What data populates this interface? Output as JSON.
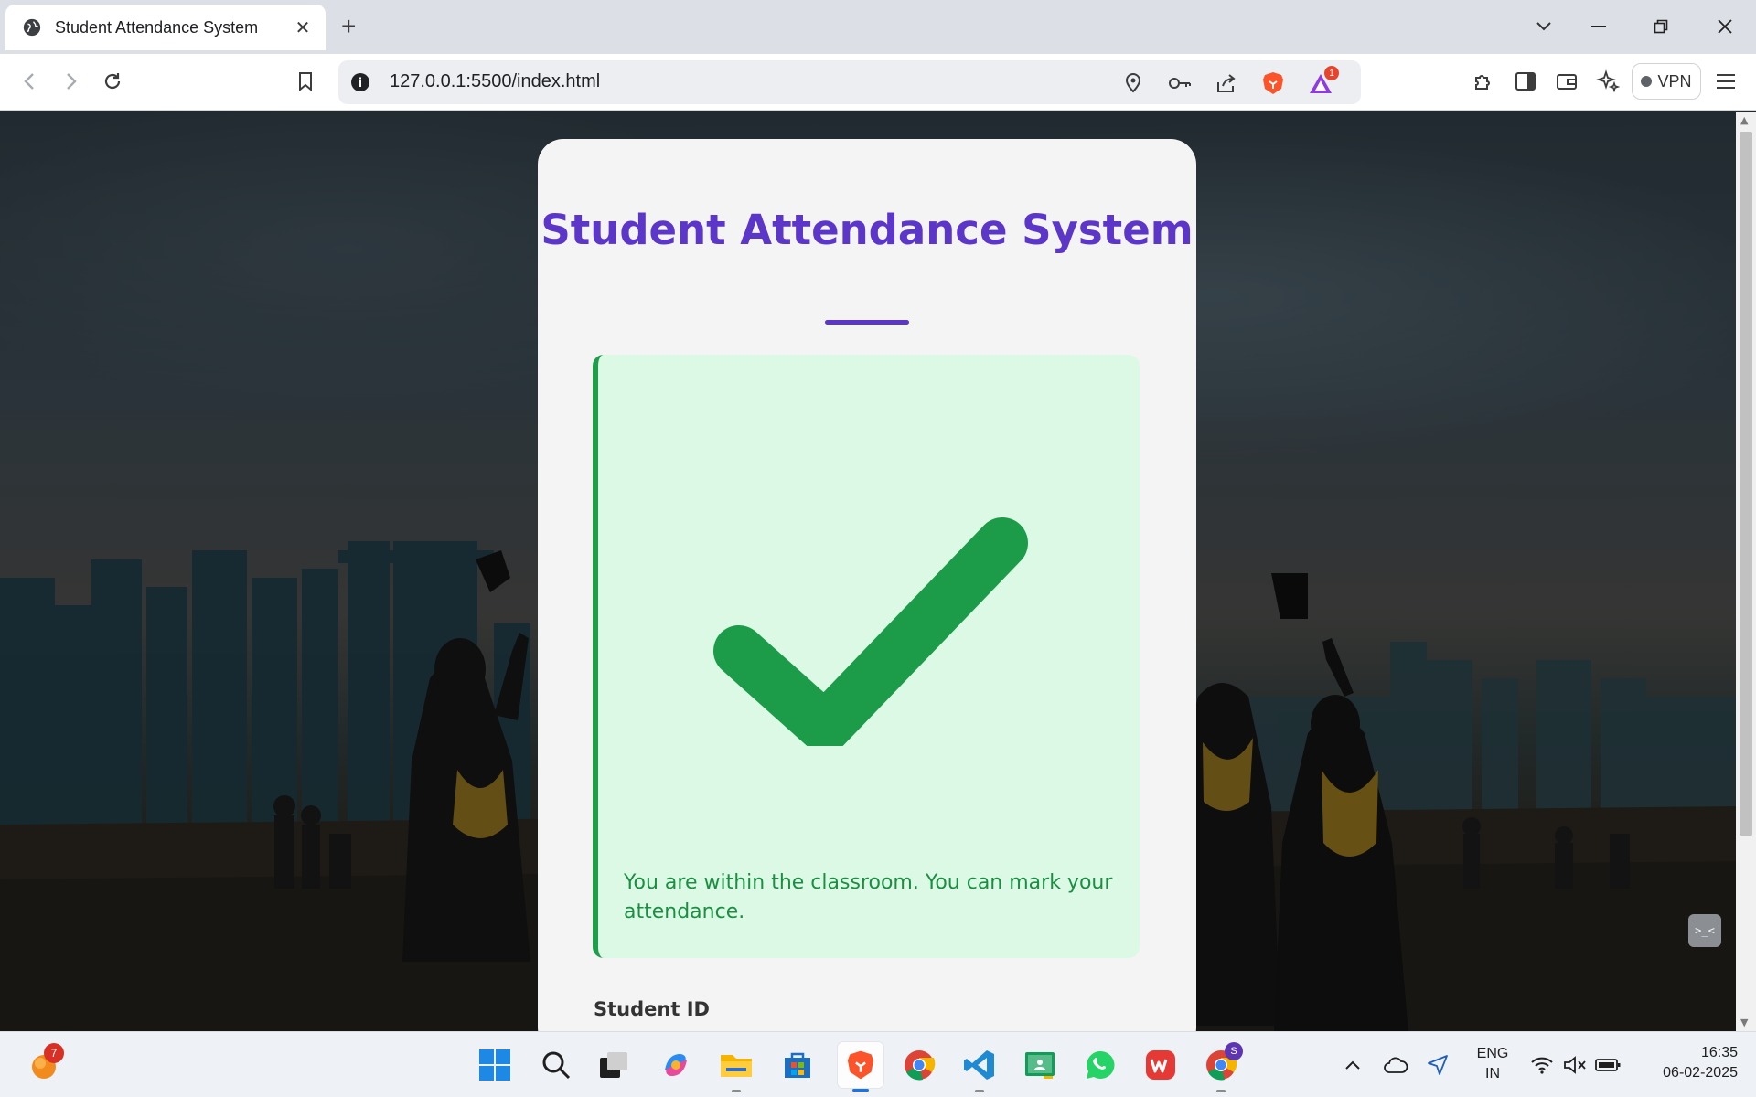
{
  "browser": {
    "tab_title": "Student Attendance System",
    "url": "127.0.0.1:5500/index.html",
    "vpn_label": "VPN",
    "rewards_badge": "1"
  },
  "page": {
    "title": "Student Attendance System",
    "status_message": "You are within the classroom. You can mark your attendance.",
    "student_id_label": "Student ID",
    "accent_color": "#5b36c9",
    "success_color": "#1e9e4a"
  },
  "taskbar": {
    "notification_badge": "7",
    "profile_badge": "S",
    "language_line1": "ENG",
    "language_line2": "IN",
    "time": "16:35",
    "date": "06-02-2025"
  }
}
